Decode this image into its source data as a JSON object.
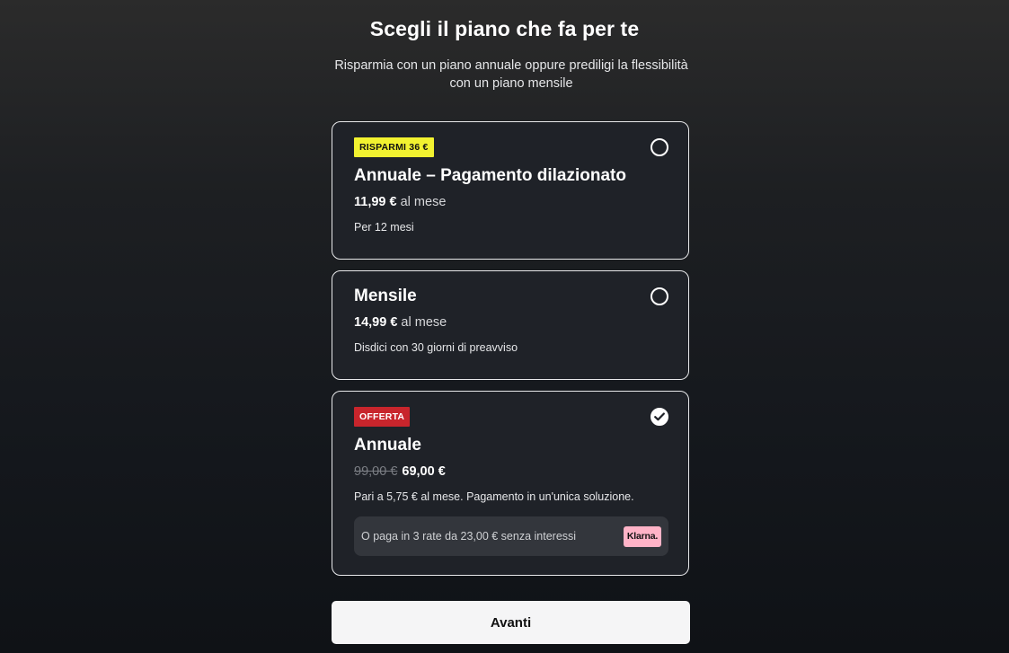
{
  "header": {
    "title": "Scegli il piano che fa per te",
    "subtitle": "Risparmia con un piano annuale oppure prediligi la flessibilità con un piano mensile"
  },
  "plans": [
    {
      "badge": "RISPARMI 36 €",
      "title": "Annuale – Pagamento dilazionato",
      "price": "11,99 €",
      "price_suffix": "al mese",
      "note": "Per 12 mesi",
      "selected": false
    },
    {
      "title": "Mensile",
      "price": "14,99 €",
      "price_suffix": "al mese",
      "note": "Disdici con 30 giorni di preavviso",
      "selected": false
    },
    {
      "badge": "OFFERTA",
      "title": "Annuale",
      "old_price": "99,00 €",
      "price": "69,00 €",
      "note": "Pari a 5,75 € al mese. Pagamento in un'unica soluzione.",
      "installments_text": "O paga in 3 rate da 23,00 € senza interessi",
      "installments_provider": "Klarna.",
      "selected": true
    }
  ],
  "footer": {
    "next_label": "Avanti"
  },
  "colors": {
    "save_badge": "#f2f230",
    "offer_badge": "#c8252c",
    "klarna_logo": "#ffb3c7"
  },
  "icons": {
    "selected_radio": "check-icon"
  }
}
